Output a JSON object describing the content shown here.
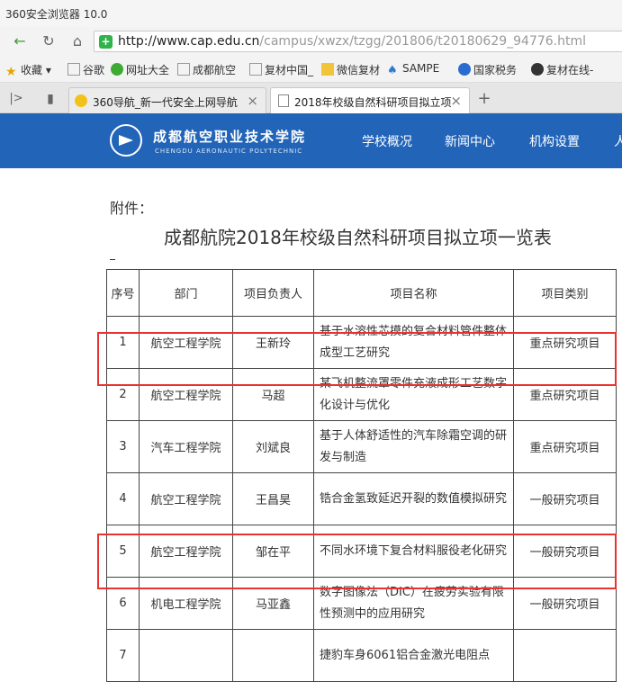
{
  "browser": {
    "title": "360安全浏览器 10.0",
    "url_host": "http://www.cap.edu.cn",
    "url_path": "/campus/xwzx/tzgg/201806/t20180629_94776.html"
  },
  "bookmarks": [
    {
      "label": "收藏",
      "icon": "star-icon"
    },
    {
      "label": "谷歌",
      "icon": "page-icon"
    },
    {
      "label": "网址大全",
      "icon": "nav-360-icon"
    },
    {
      "label": "成都航空",
      "icon": "page-icon"
    },
    {
      "label": "复材中国_",
      "icon": "page-icon"
    },
    {
      "label": "微信复材",
      "icon": "folder-icon"
    },
    {
      "label": "SAMPE",
      "icon": "sampe-icon"
    },
    {
      "label": "国家税务",
      "icon": "tax-icon"
    },
    {
      "label": "复材在线-",
      "icon": "chat-icon"
    }
  ],
  "tabs": [
    {
      "label": "360导航_新一代安全上网导航",
      "active": false
    },
    {
      "label": "2018年校级自然科研项目拟立项",
      "active": true
    }
  ],
  "site": {
    "name": "成都航空职业技术学院",
    "subname": "CHENGDU AERONAUTIC POLYTECHNIC",
    "menu": [
      "学校概况",
      "新闻中心",
      "机构设置",
      "人"
    ]
  },
  "page": {
    "attachment": "附件：",
    "heading": "成都航院2018年校级自然科研项目拟立项一览表"
  },
  "table": {
    "headers": [
      "序号",
      "部门",
      "项目负责人",
      "项目名称",
      "项目类别"
    ],
    "rows": [
      {
        "no": "1",
        "dept": "航空工程学院",
        "lead": "王新玲",
        "name": "基于水溶性芯摸的复合材料管件整体成型工艺研究",
        "type": "重点研究项目"
      },
      {
        "no": "2",
        "dept": "航空工程学院",
        "lead": "马超",
        "name": "某飞机整流罩零件充液成形工艺数字化设计与优化",
        "type": "重点研究项目"
      },
      {
        "no": "3",
        "dept": "汽车工程学院",
        "lead": "刘斌良",
        "name": "基于人体舒适性的汽车除霜空调的研发与制造",
        "type": "重点研究项目"
      },
      {
        "no": "4",
        "dept": "航空工程学院",
        "lead": "王昌昊",
        "name": "锆合金氢致延迟开裂的数值模拟研究",
        "type": "一般研究项目"
      },
      {
        "no": "5",
        "dept": "航空工程学院",
        "lead": "邹在平",
        "name": "不同水环境下复合材料服役老化研究",
        "type": "一般研究项目"
      },
      {
        "no": "6",
        "dept": "机电工程学院",
        "lead": "马亚鑫",
        "name": "数字图像法（DIC）在疲劳实验有限性预测中的应用研究",
        "type": "一般研究项目"
      },
      {
        "no": "7",
        "dept": "",
        "lead": "",
        "name": "捷豹车身6061铝合金激光电阻点",
        "type": ""
      }
    ]
  },
  "colors": {
    "header_blue": "#2164b8",
    "highlight_red": "#e8322f"
  }
}
